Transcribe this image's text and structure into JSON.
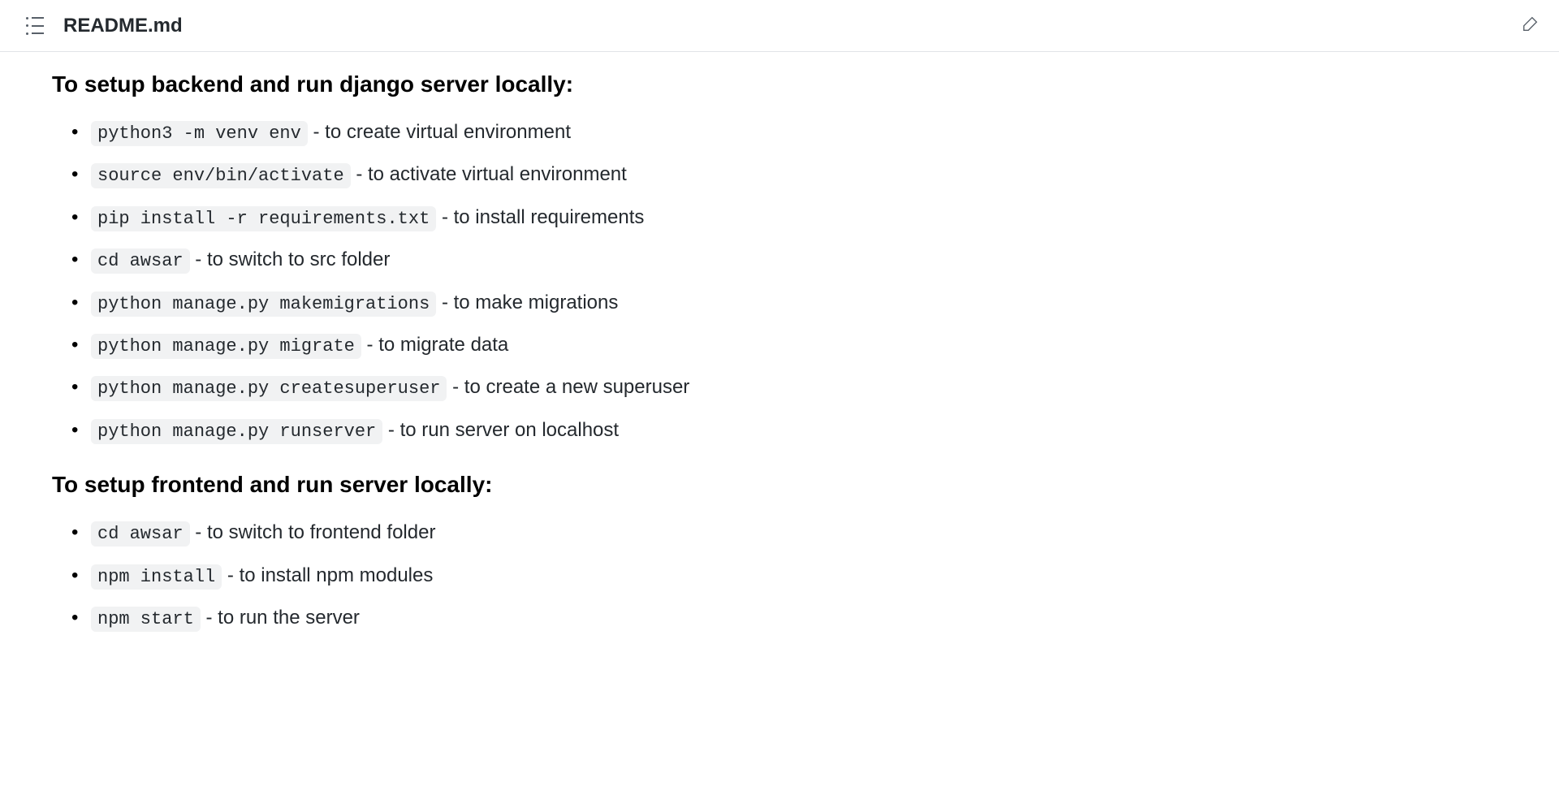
{
  "filename": "README.md",
  "sections": [
    {
      "heading": "To setup backend and run django server locally:",
      "items": [
        {
          "code": "python3 -m venv env",
          "desc": " - to create virtual environment"
        },
        {
          "code": "source env/bin/activate",
          "desc": " - to activate virtual environment"
        },
        {
          "code": "pip install -r requirements.txt",
          "desc": " - to install requirements"
        },
        {
          "code": "cd awsar",
          "desc": " - to switch to src folder"
        },
        {
          "code": "python manage.py makemigrations",
          "desc": " - to make migrations"
        },
        {
          "code": "python manage.py migrate",
          "desc": " - to migrate data"
        },
        {
          "code": "python manage.py createsuperuser",
          "desc": " - to create a new superuser"
        },
        {
          "code": "python manage.py runserver",
          "desc": " - to run server on localhost"
        }
      ]
    },
    {
      "heading": "To setup frontend and run server locally:",
      "items": [
        {
          "code": "cd awsar",
          "desc": " - to switch to frontend folder"
        },
        {
          "code": "npm install",
          "desc": " - to install npm modules"
        },
        {
          "code": "npm start",
          "desc": " - to run the server"
        }
      ]
    }
  ]
}
